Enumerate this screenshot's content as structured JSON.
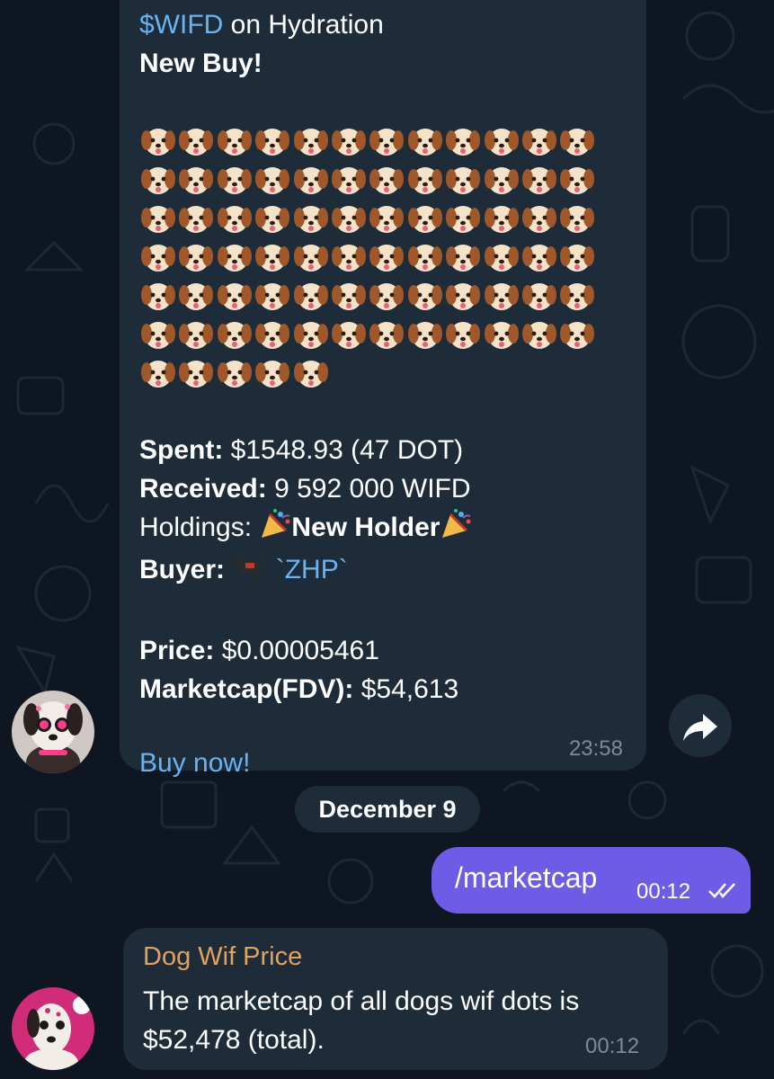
{
  "message1": {
    "token_link": "$WIFD",
    "title_rest": " on Hydration",
    "headline": "New Buy!",
    "dog_emoji_count": 77,
    "spent_label": "Spent:",
    "spent_value": " $1548.93 (47 DOT)",
    "received_label": "Received:",
    "received_value": " 9 592 000 WIFD",
    "holdings_label": "Holdings: ",
    "holdings_value": "New Holder",
    "buyer_label": "Buyer:",
    "buyer_value": "`ZHP`",
    "price_label": "Price:",
    "price_value": " $0.00005461",
    "marketcap_label": "Marketcap(FDV):",
    "marketcap_value": " $54,613",
    "cta": "Buy now!",
    "time": "23:58"
  },
  "date_separator": "December 9",
  "outgoing": {
    "text": "/marketcap",
    "time": "00:12",
    "status_icon": "double-check-icon"
  },
  "message2": {
    "sender": "Dog Wif Price",
    "text": "The marketcap of all dogs wif dots is $52,478 (total).",
    "time": "00:12"
  },
  "colors": {
    "background": "#0e1621",
    "bubble": "#1e2c3a",
    "link": "#6ab3f3",
    "outgoing": "#6f5ce6",
    "sender_name": "#e0a25c"
  }
}
